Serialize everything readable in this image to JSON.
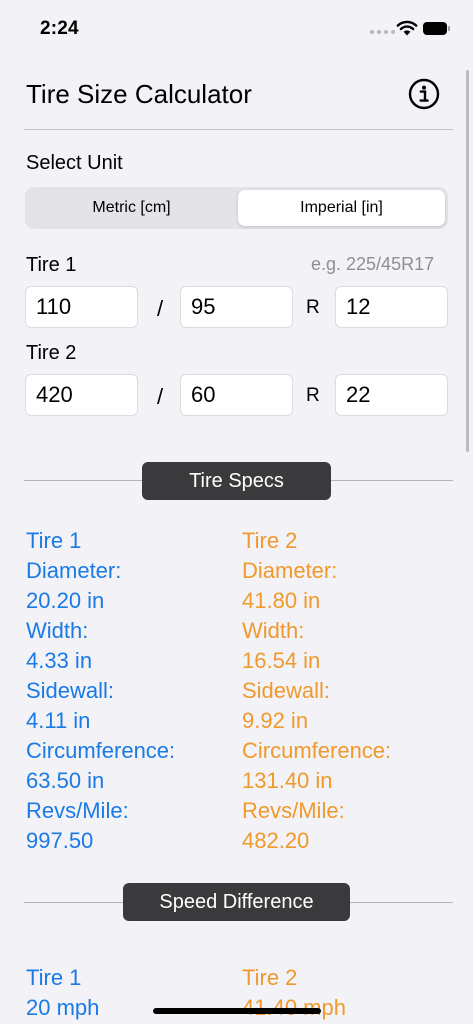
{
  "status_bar": {
    "time": "2:24"
  },
  "header": {
    "title": "Tire Size Calculator"
  },
  "unit": {
    "label": "Select Unit",
    "options": [
      "Metric [cm]",
      "Imperial [in]"
    ],
    "selected": "Imperial [in]"
  },
  "inputs": {
    "hint": "e.g. 225/45R17",
    "separator": "/",
    "rim_prefix": "R",
    "tire1": {
      "label": "Tire 1",
      "width": "110",
      "aspect": "95",
      "rim": "12"
    },
    "tire2": {
      "label": "Tire 2",
      "width": "420",
      "aspect": "60",
      "rim": "22"
    }
  },
  "specs": {
    "section_title": "Tire Specs",
    "tire1": {
      "title": "Tire 1",
      "diameter_label": "Diameter:",
      "diameter": "20.20 in",
      "width_label": "Width:",
      "width": "4.33 in",
      "sidewall_label": "Sidewall:",
      "sidewall": "4.11 in",
      "circumference_label": "Circumference:",
      "circumference": "63.50 in",
      "revs_label": "Revs/Mile:",
      "revs": "997.50"
    },
    "tire2": {
      "title": "Tire 2",
      "diameter_label": "Diameter:",
      "diameter": "41.80 in",
      "width_label": "Width:",
      "width": "16.54 in",
      "sidewall_label": "Sidewall:",
      "sidewall": "9.92 in",
      "circumference_label": "Circumference:",
      "circumference": "131.40 in",
      "revs_label": "Revs/Mile:",
      "revs": "482.20"
    }
  },
  "speed": {
    "section_title": "Speed Difference",
    "tire1": {
      "title": "Tire 1",
      "value": "20 mph"
    },
    "tire2": {
      "title": "Tire 2",
      "value": "41.40 mph"
    }
  },
  "colors": {
    "tire1": "#1a7ae6",
    "tire2": "#f0992c",
    "pill": "#3a3a3c",
    "background": "#f2f2f7"
  },
  "icons": {
    "info": "info-circle-icon",
    "wifi": "wifi-icon",
    "battery": "battery-icon",
    "signal": "cellular-signal-icon"
  }
}
